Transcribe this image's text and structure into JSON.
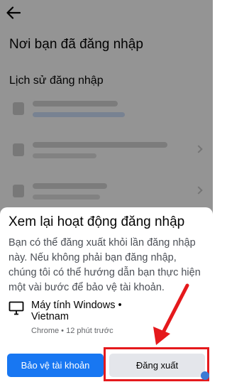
{
  "header": {
    "back_icon": "arrow-left-icon",
    "title": "Nơi bạn đã đăng nhập"
  },
  "history": {
    "section_title": "Lịch sử đăng nhập"
  },
  "sheet": {
    "title": "Xem lại hoạt động đăng nhập",
    "description": "Bạn có thể đăng xuất khỏi lần đăng nhập này. Nếu không phải bạn đăng nhập, chúng tôi có thể hướng dẫn bạn thực hiện một vài bước để bảo vệ tài khoản.",
    "session": {
      "icon": "desktop-computer-icon",
      "device": "Máy tính Windows • Vietnam",
      "meta": "Chrome • 12 phút trước"
    },
    "buttons": {
      "protect": "Bảo vệ tài khoản",
      "logout": "Đăng xuất"
    }
  },
  "colors": {
    "primary": "#1877f2",
    "secondary_button": "#e4e6eb",
    "annotation": "#e5191c"
  }
}
